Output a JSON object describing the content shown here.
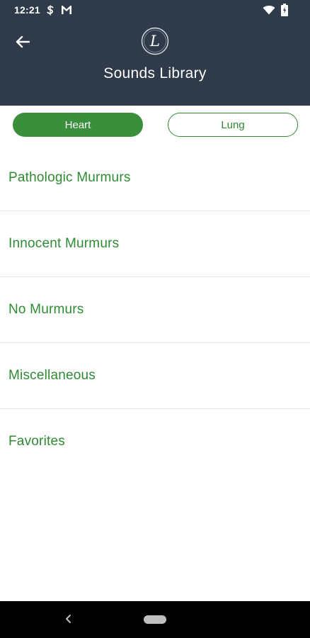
{
  "status_bar": {
    "time": "12:21",
    "icons": [
      "s-notification-icon",
      "gmail-icon",
      "wifi-icon",
      "battery-icon"
    ]
  },
  "header": {
    "title": "Sounds Library",
    "logo_letter": "L",
    "back_icon": "arrow-left-icon"
  },
  "tabs": [
    {
      "label": "Heart",
      "selected": true
    },
    {
      "label": "Lung",
      "selected": false
    }
  ],
  "categories": [
    {
      "label": "Pathologic Murmurs"
    },
    {
      "label": "Innocent Murmurs"
    },
    {
      "label": "No Murmurs"
    },
    {
      "label": "Miscellaneous"
    },
    {
      "label": "Favorites"
    }
  ],
  "nav_bar": {
    "icons": [
      "nav-back-icon",
      "nav-home-pill"
    ]
  },
  "colors": {
    "header_bg": "#2f3a4a",
    "accent_green": "#3a8f3c",
    "text_green": "#2f8a33",
    "divider": "#e6e6e6"
  }
}
